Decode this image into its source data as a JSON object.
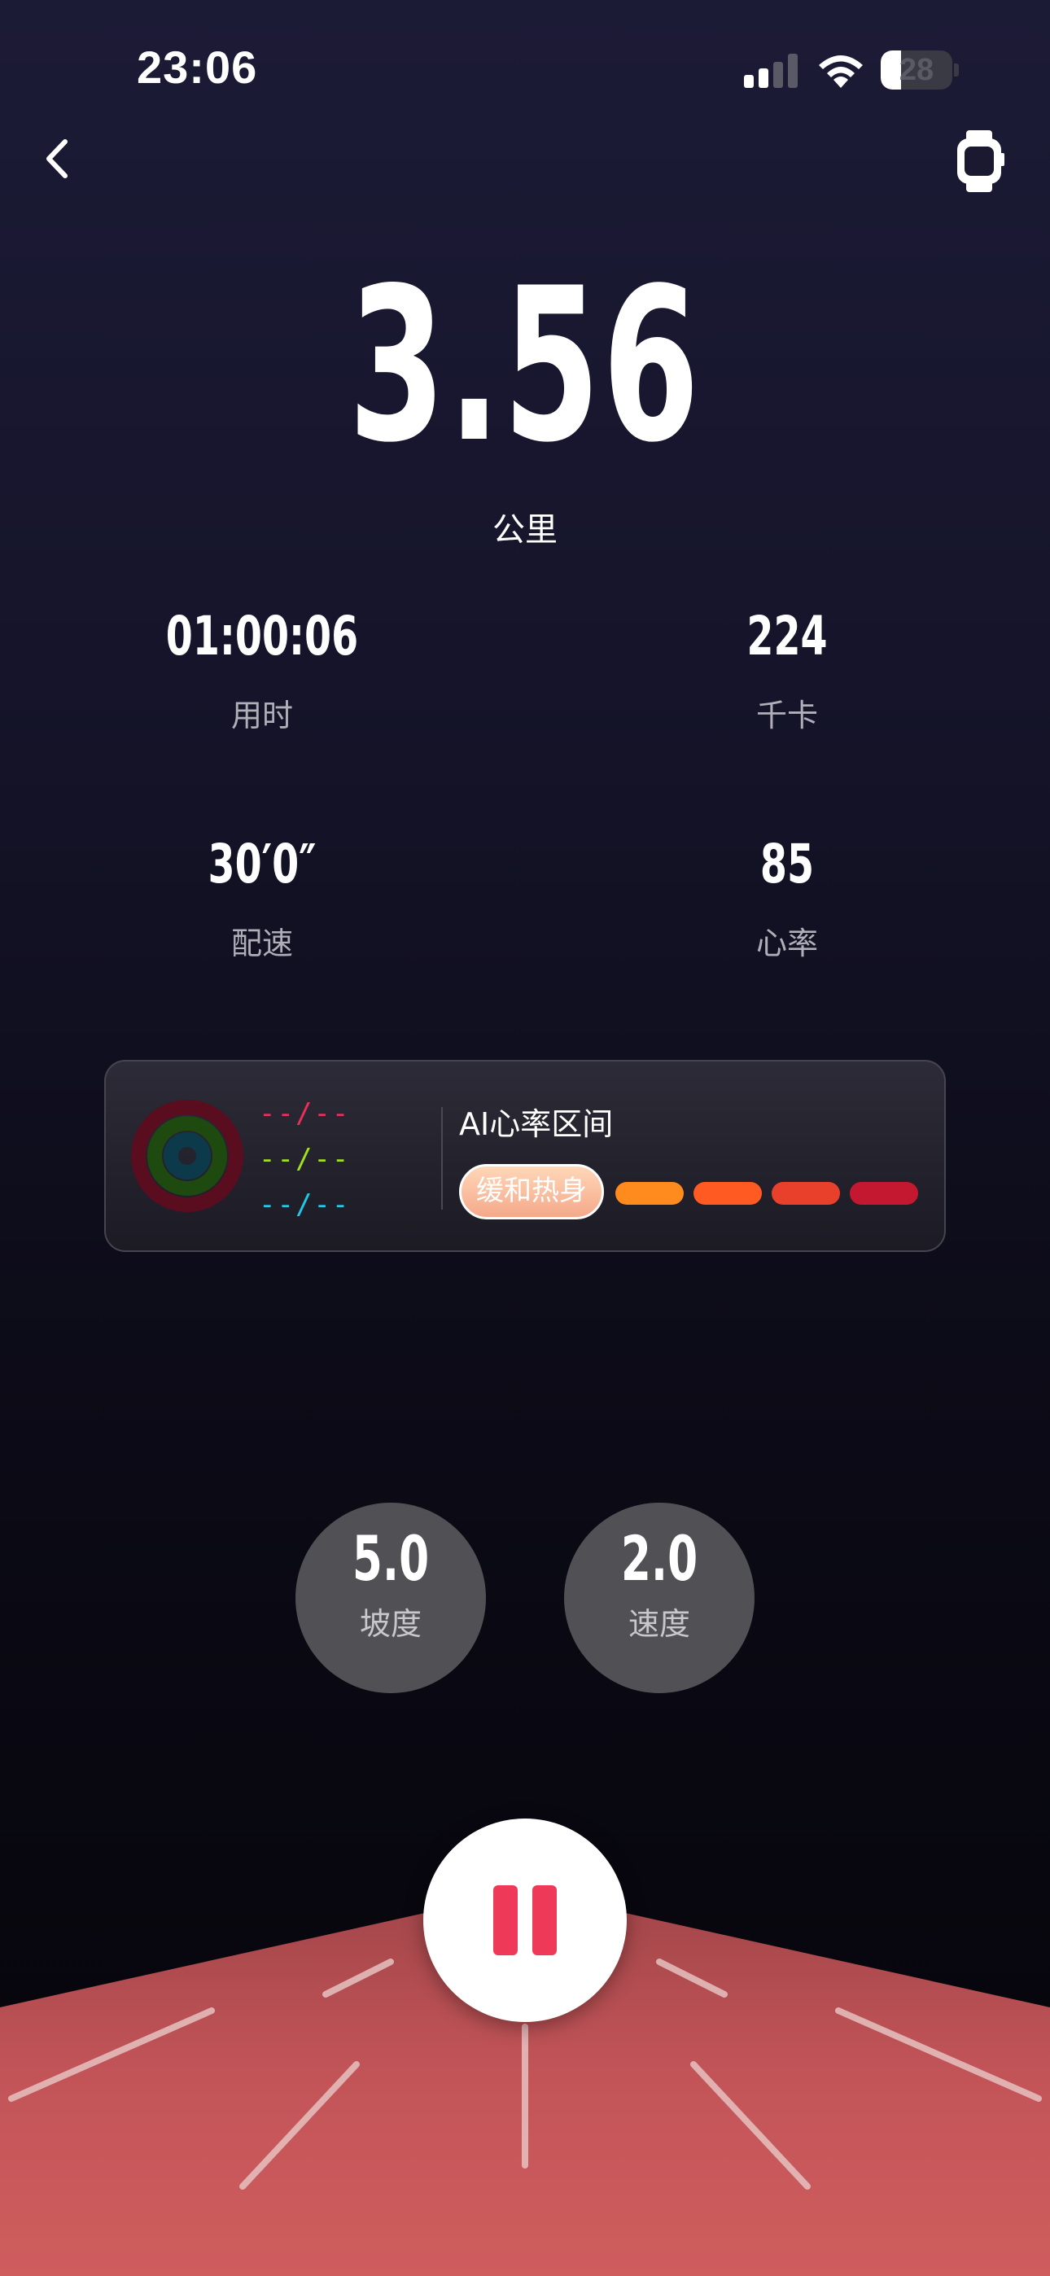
{
  "status_bar": {
    "time": "23:06",
    "battery": "28",
    "battery_level": 0.28,
    "signal_bars_active": 2,
    "icons": [
      "signal-icon",
      "wifi-icon",
      "battery-icon"
    ]
  },
  "nav": {
    "back_icon": "chevron-left-icon",
    "watch_icon": "watch-icon"
  },
  "distance": {
    "value": "3.56",
    "unit": "公里"
  },
  "stats": [
    {
      "value": "01:00:06",
      "label": "用时"
    },
    {
      "value": "224",
      "label": "千卡"
    },
    {
      "value": "30′0″",
      "label": "配速"
    },
    {
      "value": "85",
      "label": "心率"
    }
  ],
  "hr_card": {
    "title": "AI心率区间",
    "rings": [
      {
        "text": "--/--",
        "color": "#e8305a"
      },
      {
        "text": "--/--",
        "color": "#9ee21e"
      },
      {
        "text": "--/--",
        "color": "#22c8e8"
      }
    ],
    "active_zone": "缓和热身",
    "zone_colors": [
      "#ff8a1e",
      "#ff5a22",
      "#e8402a",
      "#c41830"
    ]
  },
  "controls": {
    "incline": {
      "value": "5.0",
      "label": "坡度"
    },
    "speed": {
      "value": "2.0",
      "label": "速度"
    }
  },
  "pause": {
    "icon": "pause-icon",
    "color": "#ee3a58"
  },
  "colors": {
    "background_top": "#1c1b36",
    "background_bottom": "#050409",
    "track": "#c85a5c",
    "accent": "#ee3a58"
  }
}
